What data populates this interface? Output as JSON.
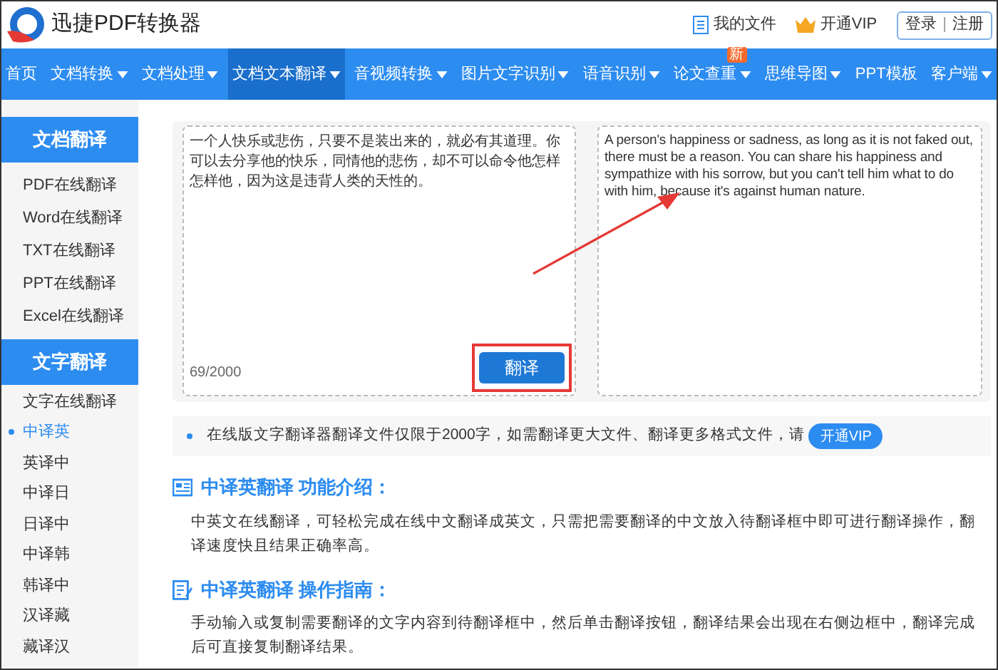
{
  "header": {
    "title": "迅捷PDF转换器",
    "links": [
      {
        "label": "我的文件",
        "kind": "file"
      },
      {
        "label": "开通VIP",
        "kind": "vip"
      }
    ],
    "auth": {
      "login": "登录",
      "separator": "|",
      "register": "注册"
    }
  },
  "nav": [
    {
      "label": "首页",
      "selected": false,
      "caret": false
    },
    {
      "label": "文档转换",
      "selected": false,
      "caret": true
    },
    {
      "label": "文档处理",
      "selected": false,
      "caret": true
    },
    {
      "label": "文档文本翻译",
      "selected": true,
      "caret": true
    },
    {
      "label": "音视频转换",
      "selected": false,
      "caret": true
    },
    {
      "label": "图片文字识别",
      "selected": false,
      "caret": true
    },
    {
      "label": "语音识别",
      "selected": false,
      "caret": true
    },
    {
      "label": "论文查重",
      "selected": false,
      "caret": true,
      "badge": "新"
    },
    {
      "label": "思维导图",
      "selected": false,
      "caret": true
    },
    {
      "label": "PPT模板",
      "selected": false,
      "caret": false
    },
    {
      "label": "客户端",
      "selected": false,
      "caret": true
    }
  ],
  "sidebar": [
    {
      "title": "文档翻译",
      "items": [
        {
          "label": "PDF在线翻译",
          "selected": false
        },
        {
          "label": "Word在线翻译",
          "selected": false
        },
        {
          "label": "TXT在线翻译",
          "selected": false
        },
        {
          "label": "PPT在线翻译",
          "selected": false
        },
        {
          "label": "Excel在线翻译",
          "selected": false
        }
      ]
    },
    {
      "title": "文字翻译",
      "items": [
        {
          "label": "文字在线翻译",
          "selected": false
        },
        {
          "label": "中译英",
          "selected": true
        },
        {
          "label": "英译中",
          "selected": false
        },
        {
          "label": "中译日",
          "selected": false
        },
        {
          "label": "日译中",
          "selected": false
        },
        {
          "label": "中译韩",
          "selected": false
        },
        {
          "label": "韩译中",
          "selected": false
        },
        {
          "label": "汉译藏",
          "selected": false
        },
        {
          "label": "藏译汉",
          "selected": false
        }
      ]
    }
  ],
  "translator": {
    "source_text": "一个人快乐或悲伤，只要不是装出来的，就必有其道理。你可以去分享他的快乐，同情他的悲伤，却不可以命令他怎样怎样他，因为这是违背人类的天性的。",
    "counter": "69/2000",
    "button": "翻译",
    "result_text": "A person's happiness or sadness, as long as it is not faked out, there must be a reason. You can share his happiness and sympathize with his sorrow, but you can't tell him what to do with him, because it's against human nature."
  },
  "notice": {
    "text": "在线版文字翻译器翻译文件仅限于2000字，如需翻译更大文件、翻译更多格式文件，请",
    "vip_button": "开通VIP"
  },
  "sections": [
    {
      "kind": "intro",
      "title": "中译英翻译 功能介绍：",
      "body": "中英文在线翻译，可轻松完成在线中文翻译成英文，只需把需要翻译的中文放入待翻译框中即可进行翻译操作，翻译速度快且结果正确率高。"
    },
    {
      "kind": "guide",
      "title": "中译英翻译 操作指南：",
      "body": "手动输入或复制需要翻译的文字内容到待翻译框中，然后单击翻译按钮，翻译结果会出现在右侧边框中，翻译完成后可直接复制翻译结果。"
    }
  ]
}
